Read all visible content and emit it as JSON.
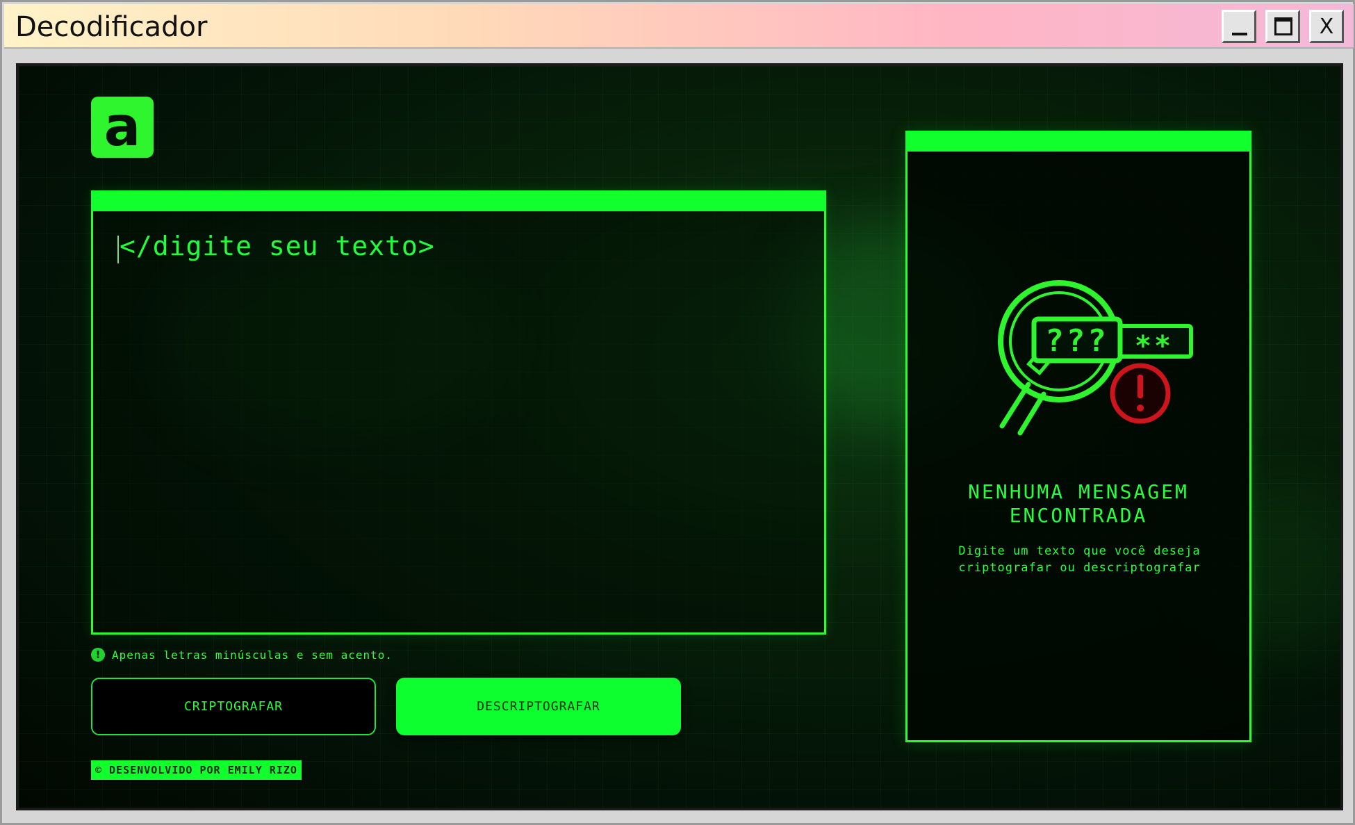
{
  "window": {
    "title": "Decodificador",
    "controls": {
      "minimize": "",
      "maximize": "",
      "close": "X"
    }
  },
  "logo": {
    "letter": "a"
  },
  "input": {
    "placeholder": "</digite seu texto>"
  },
  "hint": {
    "icon": "alert-circle-icon",
    "icon_glyph": "!",
    "text": "Apenas letras minúsculas e sem acento."
  },
  "buttons": {
    "encrypt": "CRIPTOGRAFAR",
    "decrypt": "DESCRIPTOGRAFAR"
  },
  "footer": {
    "credit": "© DESENVOLVIDO POR EMILY RIZO"
  },
  "output": {
    "title_line1": "NENHUMA MENSAGEM",
    "title_line2": "ENCONTRADA",
    "description": "Digite um texto que você deseja criptografar ou descriptografar",
    "illustration": {
      "lens_text": "???",
      "tag_text": "**",
      "alert_glyph": "!"
    }
  },
  "colors": {
    "accent": "#12ff2e",
    "background": "#031206",
    "alert": "#d0141c"
  }
}
